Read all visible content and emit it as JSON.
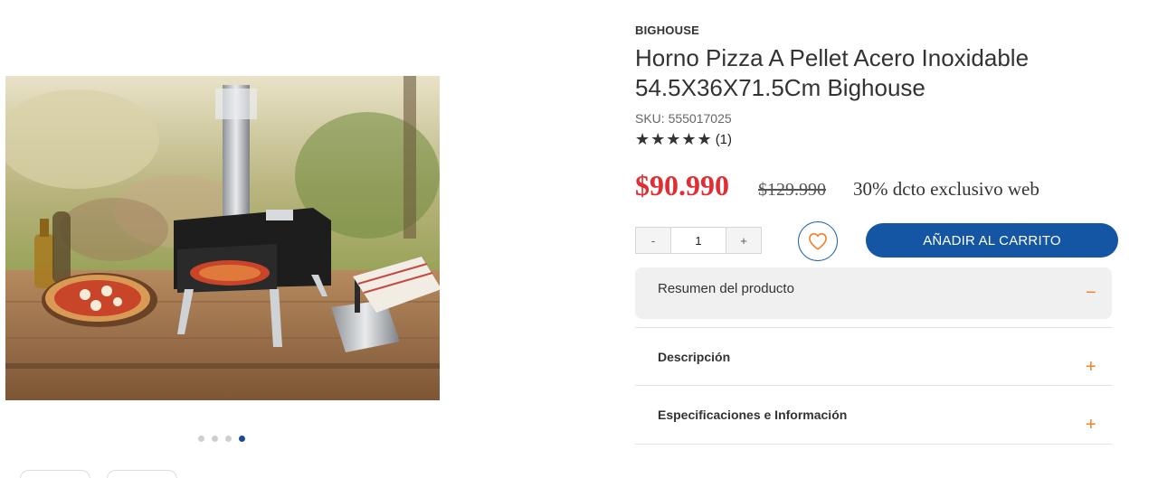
{
  "gallery": {
    "image_alt": "Horno pizza a pellet",
    "dots": [
      false,
      false,
      false,
      true
    ],
    "thumbnails": 2
  },
  "product": {
    "brand": "BIGHOUSE",
    "title_line1": "Horno Pizza A Pellet Acero Inoxidable",
    "title_line2": "54.5X36X71.5Cm Bighouse",
    "sku": "SKU: 555017025",
    "stars": "★★★★★",
    "rating_count": "(1)",
    "rating_value": 5,
    "price_current": "$90.990",
    "price_old": "$129.990",
    "discount_text": "30% dcto exclusivo web"
  },
  "purchase": {
    "minus_label": "-",
    "quantity": "1",
    "plus_label": "+",
    "add_to_cart_label": "AÑADIR AL CARRITO"
  },
  "accordion": [
    {
      "label": "Resumen del producto",
      "sign": "−",
      "open": true
    },
    {
      "label": "Descripción",
      "sign": "+",
      "open": false
    },
    {
      "label": "Especificaciones e Información",
      "sign": "+",
      "open": false
    }
  ],
  "colors": {
    "price_red": "#e02e35",
    "brand_blue": "#1456a3",
    "accent_orange": "#f0802a"
  }
}
